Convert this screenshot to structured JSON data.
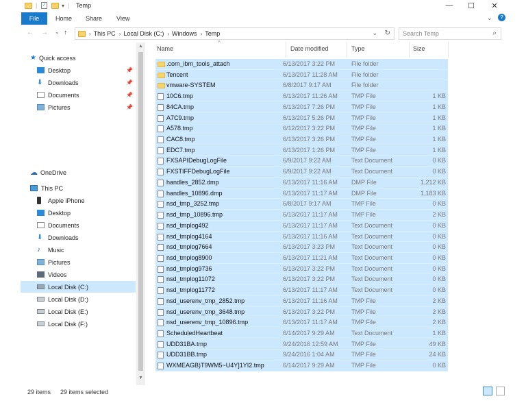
{
  "title": "Temp",
  "ribbon": {
    "tabs": [
      "File",
      "Home",
      "Share",
      "View"
    ]
  },
  "address": {
    "crumbs": [
      "This PC",
      "Local Disk (C:)",
      "Windows",
      "Temp"
    ]
  },
  "search": {
    "placeholder": "Search Temp"
  },
  "columns": {
    "name": "Name",
    "date": "Date modified",
    "type": "Type",
    "size": "Size"
  },
  "nav": {
    "quick_access": "Quick access",
    "quick_items": [
      "Desktop",
      "Downloads",
      "Documents",
      "Pictures"
    ],
    "onedrive": "OneDrive",
    "thispc": "This PC",
    "pc_items": [
      "Apple iPhone",
      "Desktop",
      "Documents",
      "Downloads",
      "Music",
      "Pictures",
      "Videos",
      "Local Disk (C:)",
      "Local Disk (D:)",
      "Local Disk (E:)",
      "Local Disk (F:)"
    ]
  },
  "files": [
    {
      "name": ".com_ibm_tools_attach",
      "date": "6/13/2017 3:22 PM",
      "type": "File folder",
      "size": "",
      "kind": "folder"
    },
    {
      "name": "Tencent",
      "date": "6/13/2017 11:28 AM",
      "type": "File folder",
      "size": "",
      "kind": "folder"
    },
    {
      "name": "vmware-SYSTEM",
      "date": "6/8/2017 9:17 AM",
      "type": "File folder",
      "size": "",
      "kind": "folder"
    },
    {
      "name": "10C6.tmp",
      "date": "6/13/2017 11:26 AM",
      "type": "TMP File",
      "size": "1 KB",
      "kind": "file"
    },
    {
      "name": "84CA.tmp",
      "date": "6/13/2017 7:26 PM",
      "type": "TMP File",
      "size": "1 KB",
      "kind": "file"
    },
    {
      "name": "A7C9.tmp",
      "date": "6/13/2017 5:26 PM",
      "type": "TMP File",
      "size": "1 KB",
      "kind": "file"
    },
    {
      "name": "A578.tmp",
      "date": "6/12/2017 3:22 PM",
      "type": "TMP File",
      "size": "1 KB",
      "kind": "file"
    },
    {
      "name": "CAC8.tmp",
      "date": "6/13/2017 3:26 PM",
      "type": "TMP File",
      "size": "1 KB",
      "kind": "file"
    },
    {
      "name": "EDC7.tmp",
      "date": "6/13/2017 1:26 PM",
      "type": "TMP File",
      "size": "1 KB",
      "kind": "file"
    },
    {
      "name": "FXSAPIDebugLogFile",
      "date": "6/9/2017 9:22 AM",
      "type": "Text Document",
      "size": "0 KB",
      "kind": "file"
    },
    {
      "name": "FXSTIFFDebugLogFile",
      "date": "6/9/2017 9:22 AM",
      "type": "Text Document",
      "size": "0 KB",
      "kind": "file"
    },
    {
      "name": "handles_2852.dmp",
      "date": "6/13/2017 11:16 AM",
      "type": "DMP File",
      "size": "1,212 KB",
      "kind": "file"
    },
    {
      "name": "handles_10896.dmp",
      "date": "6/13/2017 11:17 AM",
      "type": "DMP File",
      "size": "1,183 KB",
      "kind": "file"
    },
    {
      "name": "nsd_tmp_3252.tmp",
      "date": "6/8/2017 9:17 AM",
      "type": "TMP File",
      "size": "0 KB",
      "kind": "file"
    },
    {
      "name": "nsd_tmp_10896.tmp",
      "date": "6/13/2017 11:17 AM",
      "type": "TMP File",
      "size": "2 KB",
      "kind": "file"
    },
    {
      "name": "nsd_tmplog492",
      "date": "6/13/2017 11:17 AM",
      "type": "Text Document",
      "size": "0 KB",
      "kind": "file"
    },
    {
      "name": "nsd_tmplog4164",
      "date": "6/13/2017 11:16 AM",
      "type": "Text Document",
      "size": "0 KB",
      "kind": "file"
    },
    {
      "name": "nsd_tmplog7664",
      "date": "6/13/2017 3:23 PM",
      "type": "Text Document",
      "size": "0 KB",
      "kind": "file"
    },
    {
      "name": "nsd_tmplog8900",
      "date": "6/13/2017 11:21 AM",
      "type": "Text Document",
      "size": "0 KB",
      "kind": "file"
    },
    {
      "name": "nsd_tmplog9736",
      "date": "6/13/2017 3:22 PM",
      "type": "Text Document",
      "size": "0 KB",
      "kind": "file"
    },
    {
      "name": "nsd_tmplog11072",
      "date": "6/13/2017 3:22 PM",
      "type": "Text Document",
      "size": "0 KB",
      "kind": "file"
    },
    {
      "name": "nsd_tmplog11772",
      "date": "6/13/2017 11:17 AM",
      "type": "Text Document",
      "size": "0 KB",
      "kind": "file"
    },
    {
      "name": "nsd_userenv_tmp_2852.tmp",
      "date": "6/13/2017 11:16 AM",
      "type": "TMP File",
      "size": "2 KB",
      "kind": "file"
    },
    {
      "name": "nsd_userenv_tmp_3648.tmp",
      "date": "6/13/2017 3:22 PM",
      "type": "TMP File",
      "size": "2 KB",
      "kind": "file"
    },
    {
      "name": "nsd_userenv_tmp_10896.tmp",
      "date": "6/13/2017 11:17 AM",
      "type": "TMP File",
      "size": "2 KB",
      "kind": "file"
    },
    {
      "name": "ScheduledHeartbeat",
      "date": "6/14/2017 9:29 AM",
      "type": "Text Document",
      "size": "1 KB",
      "kind": "file"
    },
    {
      "name": "UDD31BA.tmp",
      "date": "9/24/2016 12:59 AM",
      "type": "TMP File",
      "size": "49 KB",
      "kind": "file"
    },
    {
      "name": "UDD31BB.tmp",
      "date": "9/24/2016 1:04 AM",
      "type": "TMP File",
      "size": "24 KB",
      "kind": "file"
    },
    {
      "name": "WXMEAGB)T9WM5~U4Y]1YI2.tmp",
      "date": "6/14/2017 9:29 AM",
      "type": "TMP File",
      "size": "0 KB",
      "kind": "file"
    }
  ],
  "status": {
    "count": "29 items",
    "selected": "29 items selected"
  }
}
